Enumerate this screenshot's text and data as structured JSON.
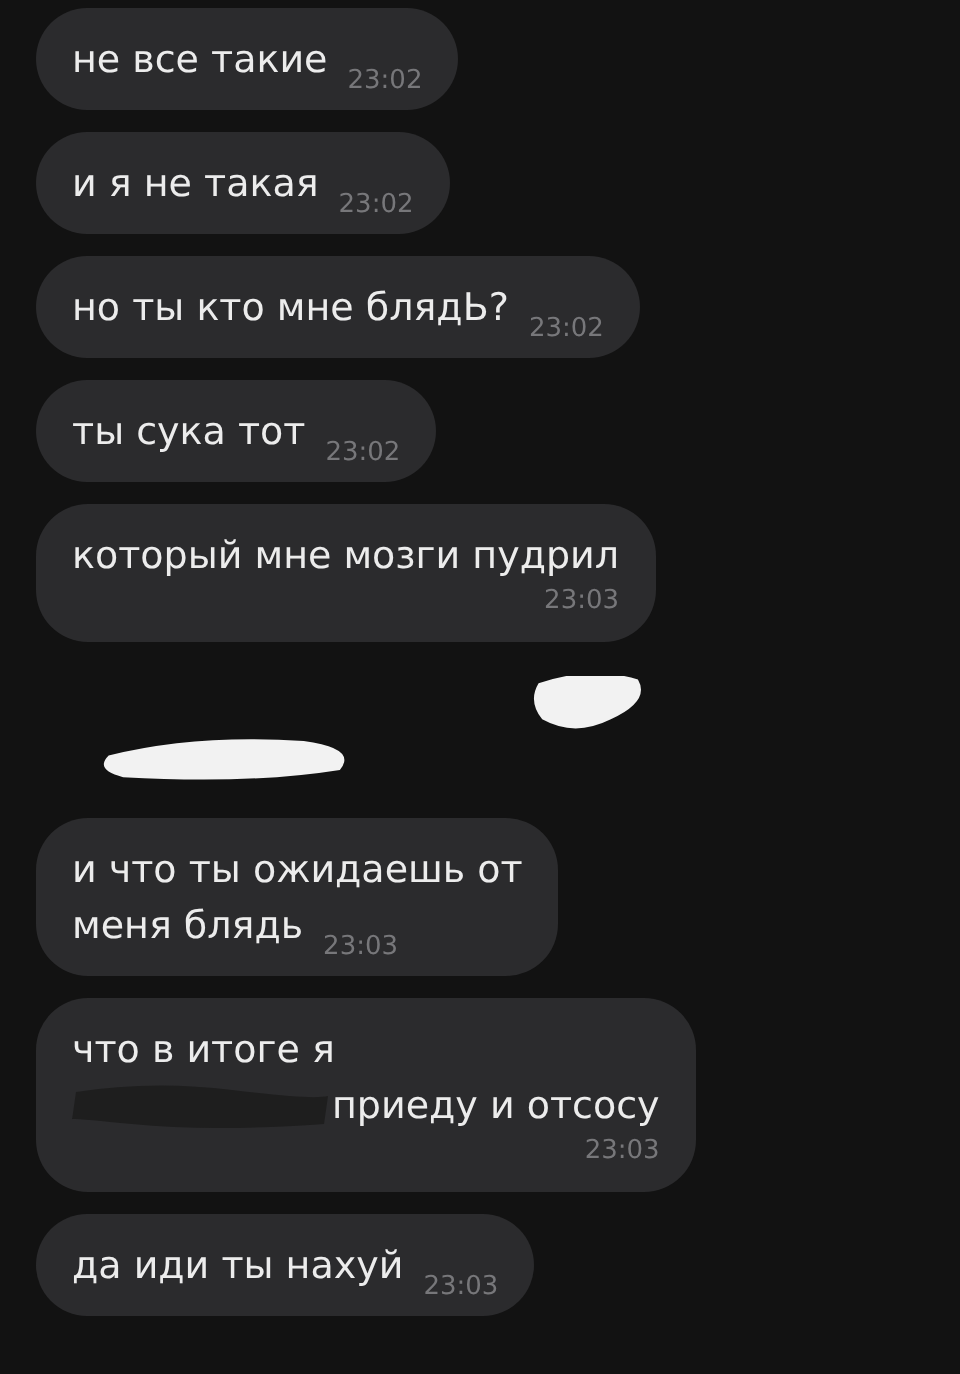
{
  "messages": [
    {
      "kind": "inline",
      "lines": [
        "не все такие"
      ],
      "time": "23:02"
    },
    {
      "kind": "inline",
      "lines": [
        "и я не такая"
      ],
      "time": "23:02"
    },
    {
      "kind": "inline",
      "lines": [
        "но ты кто мне блядЬ?"
      ],
      "time": "23:02"
    },
    {
      "kind": "inline",
      "lines": [
        "ты сука тот"
      ],
      "time": "23:02"
    },
    {
      "kind": "stacked",
      "lines": [
        "который мне мозги пудрил"
      ],
      "time": "23:03"
    },
    {
      "kind": "scribble"
    },
    {
      "kind": "inline",
      "lines": [
        "и что ты ожидаешь от",
        "меня блядь"
      ],
      "time": "23:03"
    },
    {
      "kind": "stacked",
      "lines": [
        "чтo в итоге я",
        "приеду и отсосу"
      ],
      "time": "23:03",
      "redacted": true
    },
    {
      "kind": "inline",
      "lines": [
        "да иди ты нахуй"
      ],
      "time": "23:03"
    }
  ]
}
